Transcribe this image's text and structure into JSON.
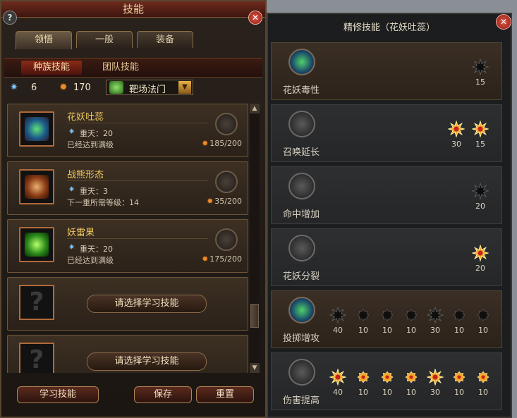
{
  "left": {
    "title": "技能",
    "help": "?",
    "close": "✕",
    "tabs": [
      "领悟",
      "一般",
      "装备"
    ],
    "subtabs": [
      "种族技能",
      "团队技能"
    ],
    "resources": {
      "blue_count": "6",
      "fire_count": "170",
      "school": "靶场法门",
      "select_arrow": "▼"
    },
    "skills": [
      {
        "name": "花妖吐蕊",
        "rank": "重天：20",
        "status": "已经达到满级",
        "cost": "185/200"
      },
      {
        "name": "战熊形态",
        "rank": "重天：3",
        "status": "下一重所需等级：14",
        "cost": "35/200"
      },
      {
        "name": "妖雷果",
        "rank": "重天：20",
        "status": "已经达到满级",
        "cost": "175/200"
      }
    ],
    "empty_slots": [
      {
        "mark": "?",
        "button": "请选择学习技能"
      },
      {
        "mark": "?",
        "button": "请选择学习技能"
      }
    ],
    "scroll": {
      "up": "▲",
      "down": "▼"
    },
    "buttons": {
      "learn": "学习技能",
      "save": "保存",
      "reset": "重置"
    }
  },
  "right": {
    "title": "精修技能（花妖吐蕊）",
    "close": "✕",
    "rows": [
      {
        "name": "花妖毒性",
        "active": true,
        "stars": [
          {
            "label": "15",
            "lit": false,
            "big": true
          }
        ]
      },
      {
        "name": "召唤延长",
        "active": false,
        "stars": [
          {
            "label": "30",
            "lit": true,
            "big": true
          },
          {
            "label": "15",
            "lit": true,
            "big": true
          }
        ]
      },
      {
        "name": "命中增加",
        "active": false,
        "stars": [
          {
            "label": "20",
            "lit": false,
            "big": true
          }
        ]
      },
      {
        "name": "花妖分裂",
        "active": false,
        "stars": [
          {
            "label": "20",
            "lit": true,
            "big": true
          }
        ]
      },
      {
        "name": "投掷增攻",
        "active": true,
        "stars": [
          {
            "label": "40",
            "lit": false,
            "big": true
          },
          {
            "label": "10",
            "lit": false,
            "big": false
          },
          {
            "label": "10",
            "lit": false,
            "big": false
          },
          {
            "label": "10",
            "lit": false,
            "big": false
          },
          {
            "label": "30",
            "lit": false,
            "big": true
          },
          {
            "label": "10",
            "lit": false,
            "big": false
          },
          {
            "label": "10",
            "lit": false,
            "big": false
          }
        ]
      },
      {
        "name": "伤害提高",
        "active": false,
        "stars": [
          {
            "label": "40",
            "lit": true,
            "big": true
          },
          {
            "label": "10",
            "lit": true,
            "big": false
          },
          {
            "label": "10",
            "lit": true,
            "big": false
          },
          {
            "label": "10",
            "lit": true,
            "big": false
          },
          {
            "label": "30",
            "lit": true,
            "big": true
          },
          {
            "label": "10",
            "lit": true,
            "big": false
          },
          {
            "label": "10",
            "lit": true,
            "big": false
          }
        ]
      }
    ]
  },
  "colors": {
    "lit_star": "#f2a72a",
    "unlit_star": "#0e0e0e",
    "accent_red": "#8b2a17",
    "gold_text": "#f0c860"
  }
}
